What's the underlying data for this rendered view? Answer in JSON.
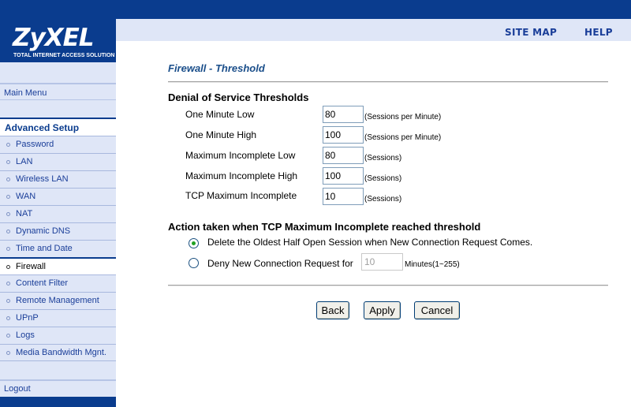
{
  "header": {
    "brand": "ZyXEL",
    "tagline": "TOTAL INTERNET ACCESS SOLUTION",
    "site_map": "SITE MAP",
    "help": "HELP"
  },
  "sidebar": {
    "main_menu": "Main Menu",
    "advanced_setup": "Advanced Setup",
    "items": [
      {
        "label": "Password"
      },
      {
        "label": "LAN"
      },
      {
        "label": "Wireless LAN"
      },
      {
        "label": "WAN"
      },
      {
        "label": "NAT"
      },
      {
        "label": "Dynamic DNS"
      },
      {
        "label": "Time and Date"
      },
      {
        "label": "Firewall"
      },
      {
        "label": "Content Filter"
      },
      {
        "label": "Remote Management"
      },
      {
        "label": "UPnP"
      },
      {
        "label": "Logs"
      },
      {
        "label": "Media Bandwidth Mgnt."
      }
    ],
    "active_item": "Firewall",
    "logout": "Logout"
  },
  "main": {
    "page_title": "Firewall - Threshold",
    "dos": {
      "title": "Denial of Service Thresholds",
      "fields": [
        {
          "label": "One Minute Low",
          "value": "80",
          "unit": "(Sessions per Minute)"
        },
        {
          "label": "One Minute High",
          "value": "100",
          "unit": "(Sessions per Minute)"
        },
        {
          "label": "Maximum Incomplete Low",
          "value": "80",
          "unit": "(Sessions)"
        },
        {
          "label": "Maximum Incomplete High",
          "value": "100",
          "unit": "(Sessions)"
        },
        {
          "label": "TCP Maximum Incomplete",
          "value": "10",
          "unit": "(Sessions)"
        }
      ]
    },
    "action": {
      "title": "Action taken when TCP Maximum Incomplete reached threshold",
      "option_delete": "Delete the Oldest Half Open Session when New Connection Request Comes.",
      "option_deny": "Deny New Connection Request for",
      "deny_value": "10",
      "deny_unit": "Minutes(1~255)",
      "selected": "delete"
    },
    "buttons": {
      "back": "Back",
      "apply": "Apply",
      "cancel": "Cancel"
    }
  },
  "colors": {
    "brand_blue": "#0a3c8e",
    "sidebar_bg": "#dfe6f7",
    "title_blue": "#1a4e8a",
    "radio_dot": "#21a121"
  }
}
